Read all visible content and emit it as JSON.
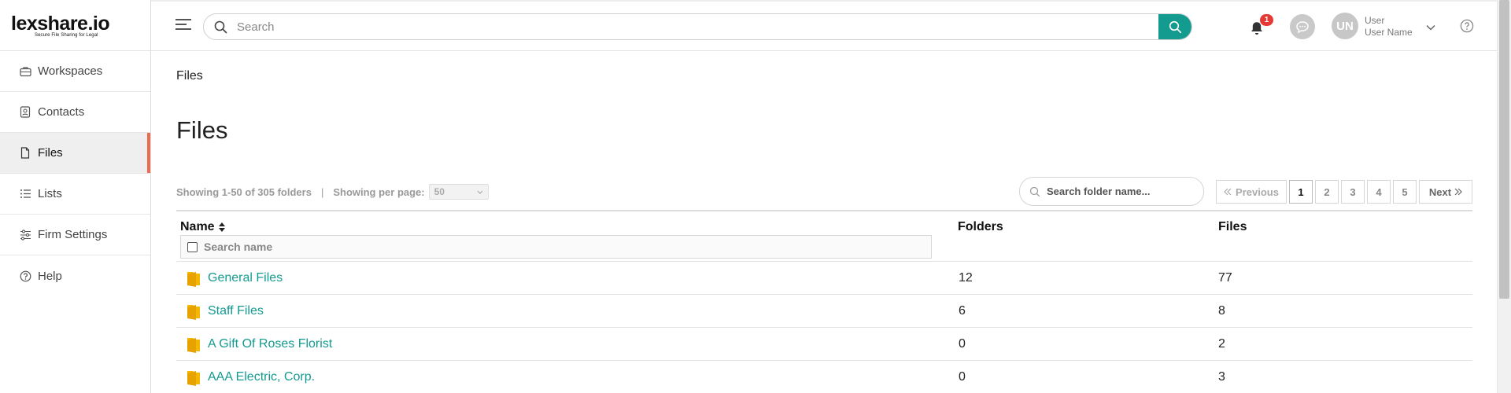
{
  "logo": {
    "brand": "lexshare.io",
    "tagline": "Secure File Sharing for Legal"
  },
  "sidebar": {
    "items": [
      {
        "label": "Workspaces",
        "icon": "briefcase-icon"
      },
      {
        "label": "Contacts",
        "icon": "contact-card-icon"
      },
      {
        "label": "Files",
        "icon": "file-icon",
        "active": true
      },
      {
        "label": "Lists",
        "icon": "list-icon"
      },
      {
        "label": "Firm Settings",
        "icon": "sliders-icon"
      },
      {
        "label": "Help",
        "icon": "help-circle-icon"
      }
    ]
  },
  "header": {
    "search_placeholder": "Search",
    "notification_count": "1",
    "avatar_initials": "UN",
    "user_role": "User",
    "user_name": "User Name"
  },
  "main": {
    "breadcrumb": "Files",
    "title": "Files",
    "showing_text": "Showing 1-50 of 305 folders",
    "separator": "|",
    "per_page_label": "Showing per page:",
    "per_page_value": "50",
    "folder_search_placeholder": "Search folder name...",
    "pagination": {
      "previous": "Previous",
      "next": "Next",
      "pages": [
        "1",
        "2",
        "3",
        "4",
        "5"
      ],
      "current": "1"
    },
    "table": {
      "columns": {
        "name": "Name",
        "folders": "Folders",
        "files": "Files"
      },
      "name_filter_placeholder": "Search name",
      "rows": [
        {
          "name": "General Files",
          "folders": "12",
          "files": "77"
        },
        {
          "name": "Staff Files",
          "folders": "6",
          "files": "8"
        },
        {
          "name": "A Gift Of Roses Florist",
          "folders": "0",
          "files": "2"
        },
        {
          "name": "AAA Electric, Corp.",
          "folders": "0",
          "files": "3"
        }
      ]
    }
  },
  "colors": {
    "accent": "#139b90",
    "active_marker": "#ee6b4d",
    "badge": "#e53935",
    "folder": "#f5b800"
  }
}
